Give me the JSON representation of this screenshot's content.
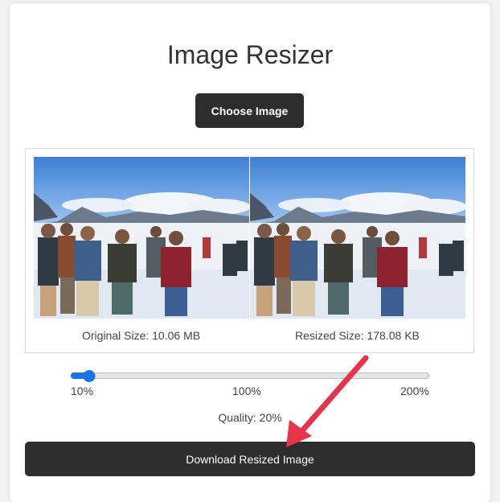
{
  "app": {
    "title": "Image Resizer",
    "choose_label": "Choose Image"
  },
  "preview": {
    "original_size_label": "Original Size: 10.06 MB",
    "resized_size_label": "Resized Size: 178.08 KB",
    "image_description": "winter crowd on snowy field"
  },
  "slider": {
    "min_label": "10%",
    "mid_label": "100%",
    "max_label": "200%",
    "min": 10,
    "max": 200,
    "value": 20
  },
  "quality": {
    "label": "Quality: 20%"
  },
  "download": {
    "label": "Download Resized Image"
  },
  "annotation": {
    "arrow_color": "#e8334a",
    "points_to": "download-resized-image-button"
  },
  "colors": {
    "button_bg": "#2d2d2d",
    "accent": "#1a73e8"
  }
}
